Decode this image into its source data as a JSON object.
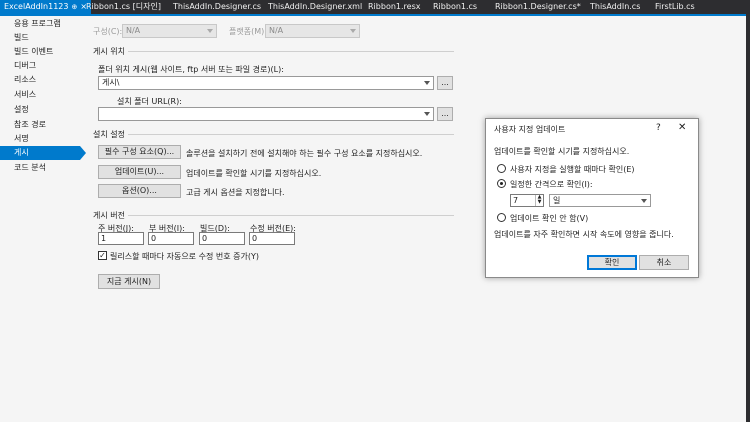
{
  "tabs": [
    {
      "label": "ExcelAddIn1123",
      "active": true
    },
    {
      "label": "Ribbon1.cs [디자인]"
    },
    {
      "label": "ThisAddIn.Designer.cs"
    },
    {
      "label": "ThisAddIn.Designer.xml"
    },
    {
      "label": "Ribbon1.resx"
    },
    {
      "label": "Ribbon1.cs"
    },
    {
      "label": "Ribbon1.Designer.cs*"
    },
    {
      "label": "ThisAddIn.cs"
    },
    {
      "label": "FirstLib.cs"
    }
  ],
  "sidebar": {
    "items": [
      {
        "label": "응용 프로그램"
      },
      {
        "label": "빌드"
      },
      {
        "label": "빌드 이벤트"
      },
      {
        "label": "디버그"
      },
      {
        "label": "리소스"
      },
      {
        "label": "서비스"
      },
      {
        "label": "설정"
      },
      {
        "label": "참조 경로"
      },
      {
        "label": "서명"
      },
      {
        "label": "게시",
        "selected": true
      },
      {
        "label": "코드 분석"
      }
    ]
  },
  "config": {
    "config_label": "구성(C):",
    "config_value": "N/A",
    "platform_label": "플랫폼(M):",
    "platform_value": "N/A"
  },
  "publish_location": {
    "heading": "게시 위치",
    "folder_label": "폴더 위치 게시(웹 사이트, ftp 서버 또는 파일 경로)(L):",
    "folder_value": "게시\\",
    "install_label": "설치 폴더 URL(R):",
    "install_value": "",
    "browse_label": "..."
  },
  "install_settings": {
    "heading": "설치 설정",
    "prereq_button": "필수 구성 요소(Q)...",
    "prereq_desc": "솔루션을 설치하기 전에 설치해야 하는 필수 구성 요소를 지정하십시오.",
    "updates_button": "업데이트(U)...",
    "updates_desc": "업데이트를 확인할 시기를 지정하십시오.",
    "options_button": "옵션(O)...",
    "options_desc": "고급 게시 옵션을 지정합니다."
  },
  "publish_version": {
    "heading": "게시 버전",
    "major_label": "주 버전(J):",
    "major_value": "1",
    "minor_label": "부 버전(I):",
    "minor_value": "0",
    "build_label": "빌드(D):",
    "build_value": "0",
    "revision_label": "수정 버전(E):",
    "revision_value": "0",
    "auto_increment_label": "릴리스할 때마다 자동으로 수정 번호 증가(Y)",
    "auto_increment_checked": "✓"
  },
  "publish_now_button": "지금 게시(N)",
  "dialog": {
    "title": "사용자 지정 업데이트",
    "help_icon": "?",
    "close_icon": "✕",
    "prompt": "업데이트를 확인할 시기를 지정하십시오.",
    "option_run": "사용자 지정을 실행할 때마다 확인(E)",
    "option_interval": "일정한 간격으로 확인(I):",
    "interval_value": "7",
    "interval_unit": "일",
    "option_never": "업데이트 확인 안 함(V)",
    "note": "업데이트를 자주 확인하면 시작 속도에 영향을 줍니다.",
    "ok_button": "확인",
    "cancel_button": "취소"
  }
}
